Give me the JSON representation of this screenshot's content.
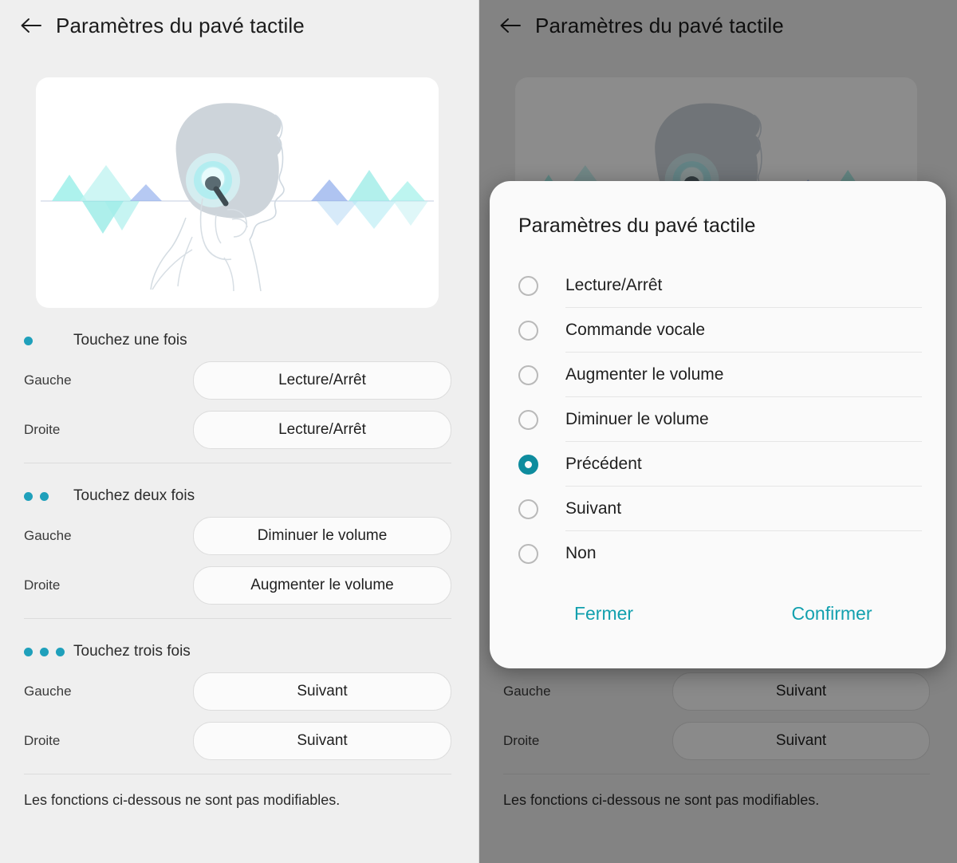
{
  "app": {
    "title": "Paramètres du pavé tactile",
    "back_icon": "arrow-left-icon",
    "accent_teal": "#1fa0bb",
    "accent_link": "#12a0ae",
    "selected_radio_color": "#0e8c9e",
    "background": "#efefef",
    "scrim": "rgba(0,0,0,0.45)"
  },
  "illustration": {
    "name": "person-tapping-earbud-illustration",
    "description": "Profil d'une tête avec écouteur et ondes sonores"
  },
  "sections": [
    {
      "id": "one-tap",
      "dot_count": 1,
      "title": "Touchez une fois",
      "rows": [
        {
          "label": "Gauche",
          "value": "Lecture/Arrêt"
        },
        {
          "label": "Droite",
          "value": "Lecture/Arrêt"
        }
      ]
    },
    {
      "id": "two-tap",
      "dot_count": 2,
      "title": "Touchez deux fois",
      "rows": [
        {
          "label": "Gauche",
          "value": "Diminuer le volume"
        },
        {
          "label": "Droite",
          "value": "Augmenter le volume"
        }
      ]
    },
    {
      "id": "three-tap",
      "dot_count": 3,
      "title": "Touchez trois fois",
      "rows": [
        {
          "label": "Gauche",
          "value": "Suivant"
        },
        {
          "label": "Droite",
          "value": "Suivant"
        }
      ]
    }
  ],
  "footer_note": "Les fonctions ci-dessous ne sont pas modifiables.",
  "dialog": {
    "title": "Paramètres du pavé tactile",
    "selected_index": 4,
    "options": [
      "Lecture/Arrêt",
      "Commande vocale",
      "Augmenter le volume",
      "Diminuer le volume",
      "Précédent",
      "Suivant",
      "Non"
    ],
    "close_label": "Fermer",
    "confirm_label": "Confirmer"
  }
}
